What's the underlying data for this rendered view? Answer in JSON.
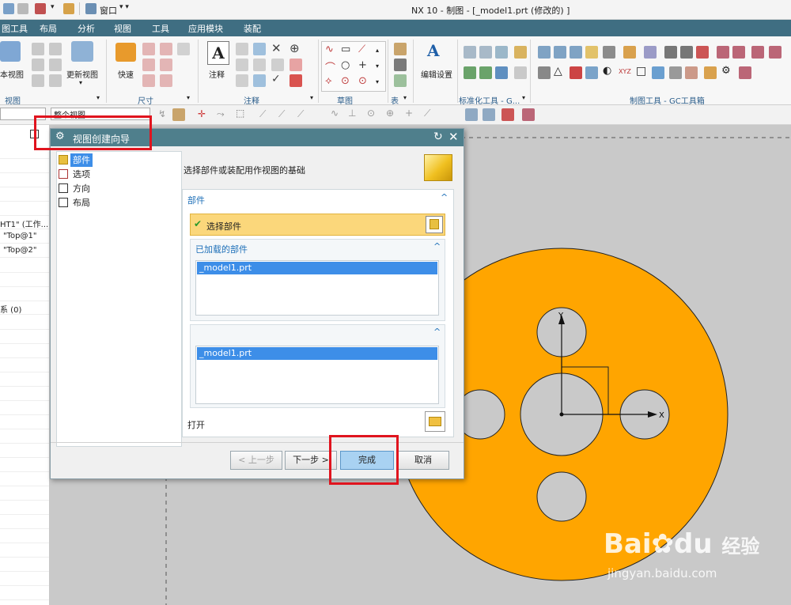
{
  "window": {
    "title": "NX 10 - 制图 - [_model1.prt  (修改的) ]",
    "quick_access": {
      "window_menu_label": "窗口"
    }
  },
  "menubar": {
    "items": [
      "图工具",
      "布局",
      "分析",
      "视图",
      "工具",
      "应用模块",
      "装配"
    ]
  },
  "ribbon": {
    "view_group": {
      "base_view_label": "本视图",
      "update_view_label": "更新视图",
      "group_label": "视图"
    },
    "dimension_group": {
      "quick_label": "快速",
      "group_label": "尺寸"
    },
    "annotation_group": {
      "note_label": "注释",
      "group_label": "注释"
    },
    "sketch_group": {
      "group_label": "草图"
    },
    "table_group": {
      "group_label": "表"
    },
    "settings_group": {
      "edit_settings_label": "编辑设置"
    },
    "standardize_group": {
      "group_label": "标准化工具 - G..."
    },
    "gc_group": {
      "group_label": "制图工具 - GC工具箱"
    }
  },
  "toolbar2": {
    "selection_filter_value": "整个视图"
  },
  "navigator": {
    "rows": [
      "HT1\" (工作...",
      "\"Top@1\"",
      "\"Top@2\"",
      "系 (0)"
    ]
  },
  "dialog": {
    "title": "视图创建向导",
    "steps": [
      {
        "label": "部件",
        "icon": "part-icon",
        "selected": true
      },
      {
        "label": "选项",
        "icon": "options-icon",
        "selected": false
      },
      {
        "label": "方向",
        "icon": "orientation-icon",
        "selected": false
      },
      {
        "label": "布局",
        "icon": "layout-icon",
        "selected": false
      }
    ],
    "instruction": "选择部件或装配用作视图的基础",
    "part_section": {
      "header": "部件",
      "select_part_label": "选择部件",
      "loaded_parts_header": "已加载的部件",
      "loaded_parts": [
        "_model1.prt"
      ],
      "recent_parts": [
        "_model1.prt"
      ],
      "open_label": "打开"
    },
    "buttons": {
      "back": "< 上一步",
      "next": "下一步 >",
      "finish": "完成",
      "cancel": "取消"
    }
  },
  "canvas": {
    "part_color": "#ffa500",
    "axis_x_label": "X",
    "axis_y_label": "Y"
  },
  "highlight_color": "#e0141e",
  "watermark": {
    "brand": "Bai",
    "brand2": "du",
    "site_cn": "经验",
    "url": "jingyan.baidu.com"
  }
}
